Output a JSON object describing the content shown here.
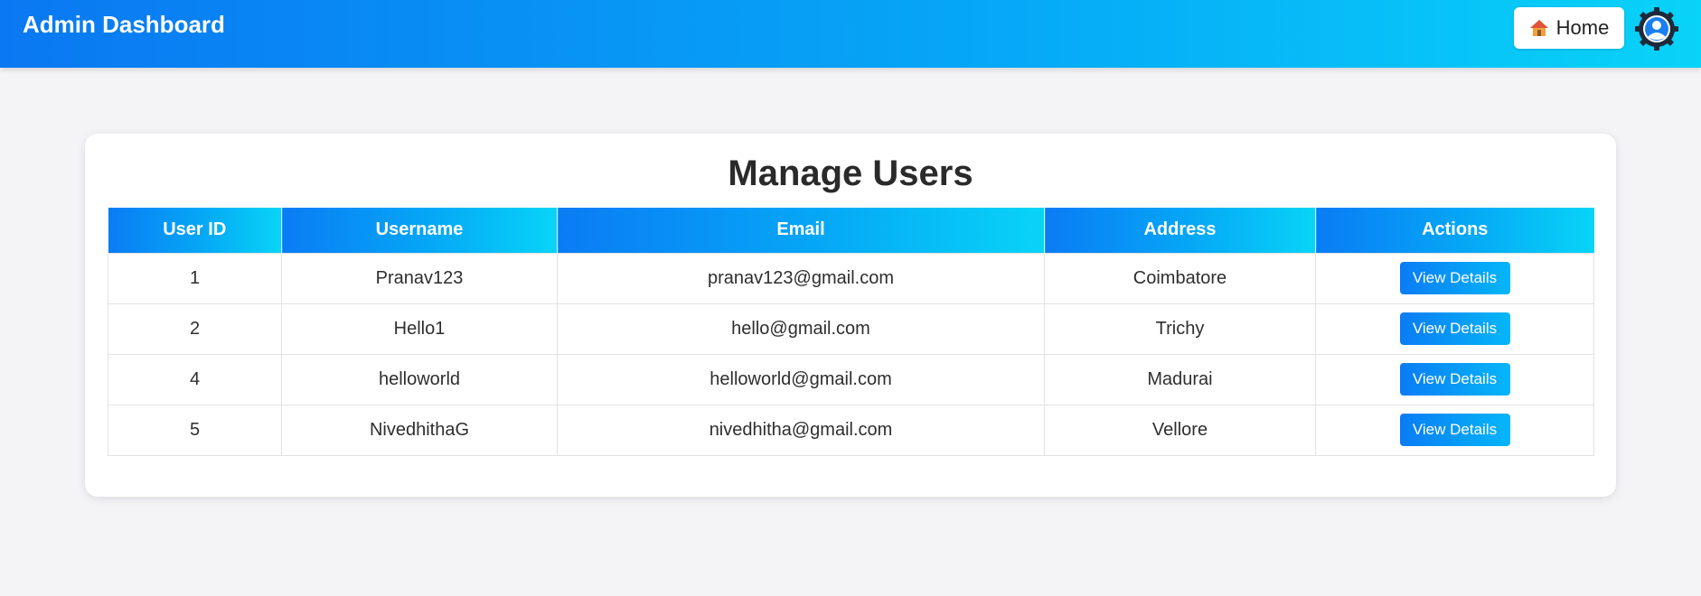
{
  "header": {
    "title": "Admin Dashboard",
    "home_label": "Home"
  },
  "colors": {
    "accent": "#0a7cf5",
    "accent_light": "#08d4f7",
    "background": "#f4f4f7"
  },
  "page": {
    "title": "Manage Users"
  },
  "table": {
    "columns": [
      "User ID",
      "Username",
      "Email",
      "Address",
      "Actions"
    ],
    "rows": [
      {
        "id": "1",
        "username": "Pranav123",
        "email": "pranav123@gmail.com",
        "address": "Coimbatore",
        "action": "View Details"
      },
      {
        "id": "2",
        "username": "Hello1",
        "email": "hello@gmail.com",
        "address": "Trichy",
        "action": "View Details"
      },
      {
        "id": "4",
        "username": "helloworld",
        "email": "helloworld@gmail.com",
        "address": "Madurai",
        "action": "View Details"
      },
      {
        "id": "5",
        "username": "NivedhithaG",
        "email": "nivedhitha@gmail.com",
        "address": "Vellore",
        "action": "View Details"
      }
    ]
  }
}
